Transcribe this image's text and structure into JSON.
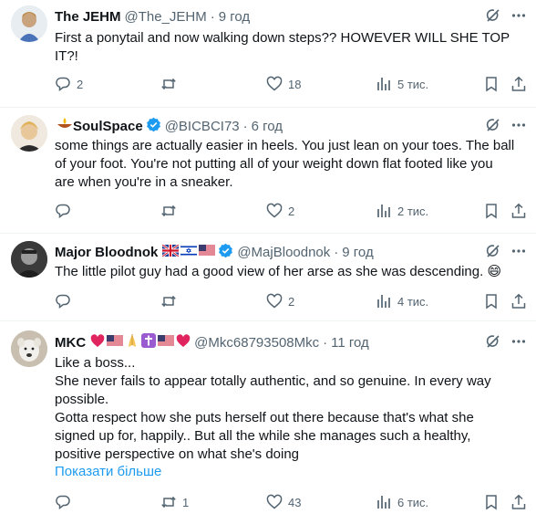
{
  "tweets": [
    {
      "name": "The JEHM",
      "handle": "@The_JEHM",
      "sep": "·",
      "time": "9 год",
      "lines": [
        "First a ponytail and now walking down steps?? HOWEVER WILL SHE TOP",
        "IT?!"
      ],
      "replies": "2",
      "retweets": "",
      "likes": "18",
      "views": "5 тис."
    },
    {
      "name": "SoulSpace",
      "handle": "@BICBCI73",
      "sep": "·",
      "time": "6 год",
      "lines": [
        "some things are actually easier in heels. You just lean on your toes. The ball",
        "of your foot. You're not putting all of your weight down flat footed like you",
        "are when you're in a sneaker."
      ],
      "replies": "",
      "retweets": "",
      "likes": "2",
      "views": "2 тис."
    },
    {
      "name": "Major Bloodnok",
      "handle": "@MajBloodnok",
      "sep": "·",
      "time": "9 год",
      "lines": [
        "The little pilot guy had a good view of her arse as she was descending. 😄"
      ],
      "replies": "",
      "retweets": "",
      "likes": "2",
      "views": "4 тис."
    },
    {
      "name": "MKC",
      "handle": "@Mkc68793508Mkc",
      "sep": "·",
      "time": "11 год",
      "lines": [
        "Like a boss...",
        "She never fails to appear totally authentic, and so genuine. In every way",
        "possible.",
        "Gotta respect how she puts herself out there because that's what she",
        "signed up for, happily.. But all the while she manages such a healthy,",
        "positive perspective on what she's doing"
      ],
      "show_more": "Показати більше",
      "replies": "",
      "retweets": "1",
      "likes": "43",
      "views": "6 тис."
    }
  ],
  "colors": {
    "text": "#0f1419",
    "muted": "#536471",
    "link": "#1d9bf0",
    "border": "#eff3f4",
    "verified": "#1d9bf0"
  },
  "icons": [
    "grok-icon",
    "more-icon",
    "reply-icon",
    "retweet-icon",
    "like-icon",
    "views-icon",
    "bookmark-icon",
    "share-icon",
    "verified-badge-icon"
  ]
}
